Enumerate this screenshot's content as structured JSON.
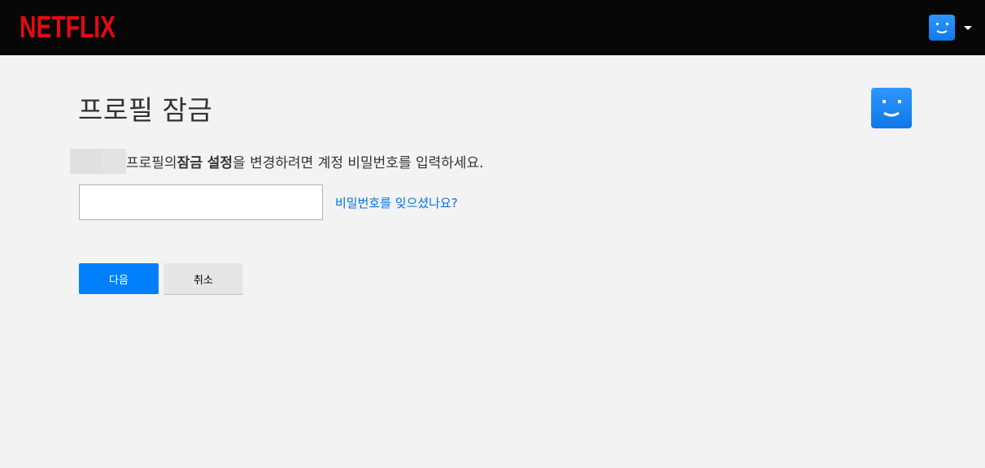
{
  "header": {
    "logo_text": "NETFLIX",
    "logo_color": "#e50914",
    "account_avatar_icon": "smiley-face-icon",
    "account_menu_icon": "caret-down-icon"
  },
  "main": {
    "title": "프로필 잠금",
    "profile_avatar_icon": "smiley-face-icon",
    "description": {
      "prefix": "프로필의 ",
      "bold": "잠금 설정",
      "suffix": "을 변경하려면 계정 비밀번호를 입력하세요."
    },
    "password_input": {
      "value": "",
      "placeholder": ""
    },
    "forgot_password_link": "비밀번호를 잊으셨나요?",
    "next_button": "다음",
    "cancel_button": "취소"
  },
  "colors": {
    "header_bg": "#070707",
    "page_bg": "#f3f3f3",
    "primary_button": "#0080ff",
    "link": "#0071eb",
    "avatar_blue": "#1a86f5"
  }
}
